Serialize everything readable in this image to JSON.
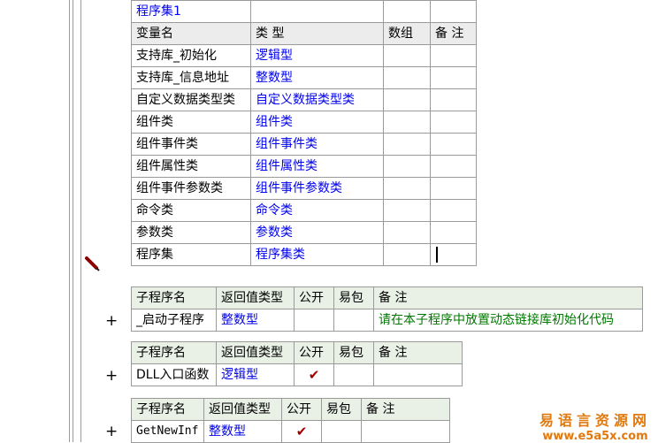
{
  "program_set": {
    "name": "程序集1",
    "headers": [
      "变量名",
      "类 型",
      "数组",
      "备 注"
    ],
    "rows": [
      {
        "name": "支持库_初始化",
        "type": "逻辑型"
      },
      {
        "name": "支持库_信息地址",
        "type": "整数型"
      },
      {
        "name": "自定义数据类型类",
        "type": "自定义数据类型类"
      },
      {
        "name": "组件类",
        "type": "组件类"
      },
      {
        "name": "组件事件类",
        "type": "组件事件类"
      },
      {
        "name": "组件属性类",
        "type": "组件属性类"
      },
      {
        "name": "组件事件参数类",
        "type": "组件事件参数类"
      },
      {
        "name": "命令类",
        "type": "命令类"
      },
      {
        "name": "参数类",
        "type": "参数类"
      },
      {
        "name": "程序集",
        "type": "程序集类"
      }
    ]
  },
  "subroutine_headers": [
    "子程序名",
    "返回值类型",
    "公开",
    "易包",
    "备 注"
  ],
  "subroutines": [
    {
      "name": "_启动子程序",
      "return_type": "整数型",
      "public": "",
      "package": "",
      "remark": "请在本子程序中放置动态链接库初始化代码"
    },
    {
      "name": "DLL入口函数",
      "return_type": "逻辑型",
      "public": "✔",
      "package": "",
      "remark": ""
    },
    {
      "name": "GetNewInf",
      "return_type": "整数型",
      "public": "✔",
      "package": "",
      "remark": ""
    }
  ],
  "expand_symbol": "+",
  "icons": {
    "edit": "pencil-icon",
    "expand": "plus-icon",
    "check": "check-icon"
  },
  "colors": {
    "type_text": "#0000ee",
    "remark_text": "#007700",
    "check": "#a00000",
    "border": "#9a9a9a",
    "watermark": "#e07a10"
  },
  "watermark": {
    "line1": "易语言资源网",
    "line2": "www.e5a5x.com"
  }
}
